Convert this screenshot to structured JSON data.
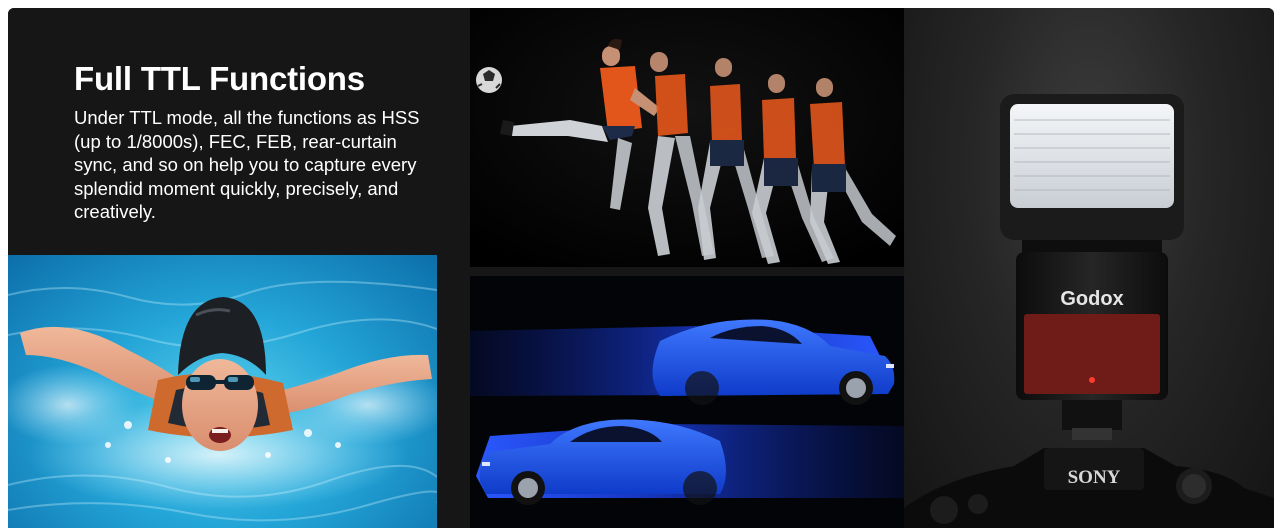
{
  "banner": {
    "headline": "Full TTL Functions",
    "description": "Under TTL mode, all the functions as HSS (up to 1/8000s), FEC, FEB, rear-curtain sync, and so on help you to capture every splendid moment quickly, precisely, and creatively."
  },
  "flash": {
    "brand": "Godox"
  },
  "camera": {
    "brand": "SONY"
  }
}
